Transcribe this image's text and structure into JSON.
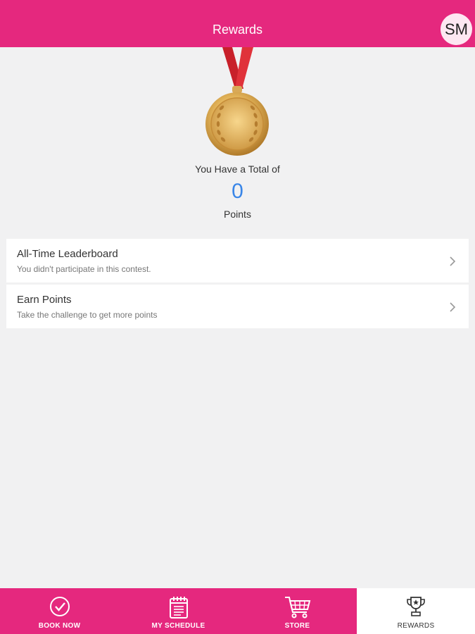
{
  "header": {
    "title": "Rewards",
    "avatar_initials": "SM"
  },
  "summary": {
    "total_label": "You Have a Total of",
    "points_value": "0",
    "points_label": "Points"
  },
  "cards": [
    {
      "title": "All-Time Leaderboard",
      "subtitle": "You didn't participate in this contest."
    },
    {
      "title": "Earn Points",
      "subtitle": "Take the challenge to get more points"
    }
  ],
  "tabs": [
    {
      "label": "BOOK NOW",
      "icon": "check-circle-icon"
    },
    {
      "label": "MY SCHEDULE",
      "icon": "calendar-icon"
    },
    {
      "label": "STORE",
      "icon": "cart-icon"
    },
    {
      "label": "REWARDS",
      "icon": "trophy-icon",
      "active": true
    }
  ],
  "colors": {
    "brand": "#e5287e",
    "points": "#3a86e8",
    "background": "#f1f1f2"
  }
}
